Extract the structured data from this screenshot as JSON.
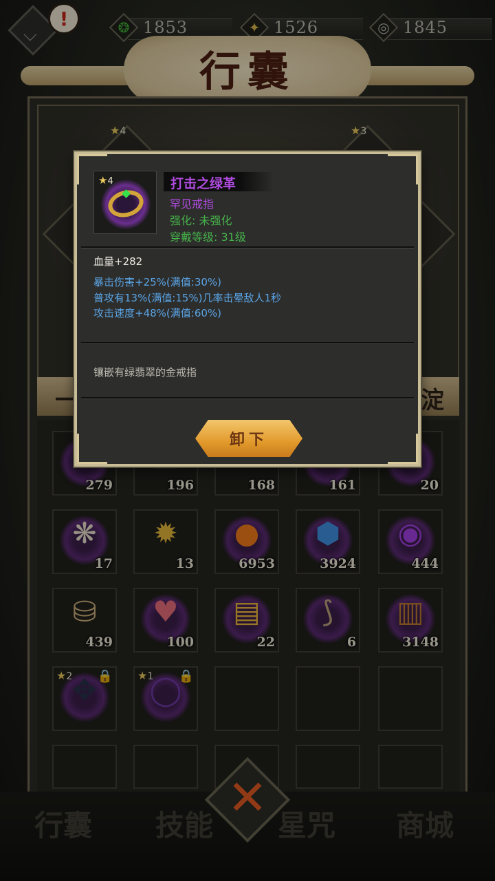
{
  "currencies": [
    {
      "icon": "green-jade-icon",
      "value": "1853",
      "color": "#3fae3a"
    },
    {
      "icon": "gold-coin-icon",
      "value": "1526",
      "color": "#d9b44a"
    },
    {
      "icon": "silver-swirl-icon",
      "value": "1845",
      "color": "#b8b8b8"
    }
  ],
  "header": {
    "title": "行囊",
    "alert": "!"
  },
  "equipped": {
    "slot_left_stars": "4",
    "slot_right_stars": "3"
  },
  "tabs": {
    "left": "一",
    "right": "淀"
  },
  "inventory": [
    {
      "qty": "279",
      "icon": "red-item-icon"
    },
    {
      "qty": "196",
      "icon": "scroll-item-icon"
    },
    {
      "qty": "168",
      "icon": "armor-item-icon"
    },
    {
      "qty": "161",
      "icon": "pouch-item-icon"
    },
    {
      "qty": "20",
      "icon": "scroll-bag-icon"
    },
    {
      "qty": "17",
      "icon": "crane-charm-icon"
    },
    {
      "qty": "13",
      "icon": "gold-star-medal-icon"
    },
    {
      "qty": "6953",
      "icon": "orange-orb-icon"
    },
    {
      "qty": "3924",
      "icon": "blue-crystal-icon"
    },
    {
      "qty": "444",
      "icon": "purple-orb-icon"
    },
    {
      "qty": "439",
      "icon": "rice-sack-icon"
    },
    {
      "qty": "100",
      "icon": "peach-icon"
    },
    {
      "qty": "22",
      "icon": "talisman-scroll-icon"
    },
    {
      "qty": "6",
      "icon": "fish-icon"
    },
    {
      "qty": "3148",
      "icon": "wooden-bucket-icon"
    },
    {
      "stars": "2",
      "icon": "feather-mask-icon",
      "locked": true
    },
    {
      "stars": "1",
      "icon": "purple-ring-icon",
      "locked": true
    }
  ],
  "tooltip": {
    "stars": "4",
    "name": "打击之绿革",
    "rarity": "罕见戒指",
    "enhance": "强化: 未强化",
    "level": "穿戴等级: 31级",
    "base_stat": "血量+282",
    "bonus_stats": [
      "暴击伤害+25%(满值:30%)",
      "普攻有13%(满值:15%)几率击晕敌人1秒",
      "攻击速度+48%(满值:60%)"
    ],
    "description": "镶嵌有绿翡翠的金戒指",
    "unequip_label": "卸下"
  },
  "bottom_nav": [
    "行囊",
    "技能",
    "星咒",
    "商城"
  ],
  "colors": {
    "accent": "#e29a2c",
    "rare_purple": "#b04ce0",
    "stat_blue": "#5aa5e6",
    "green_text": "#46b34a"
  }
}
